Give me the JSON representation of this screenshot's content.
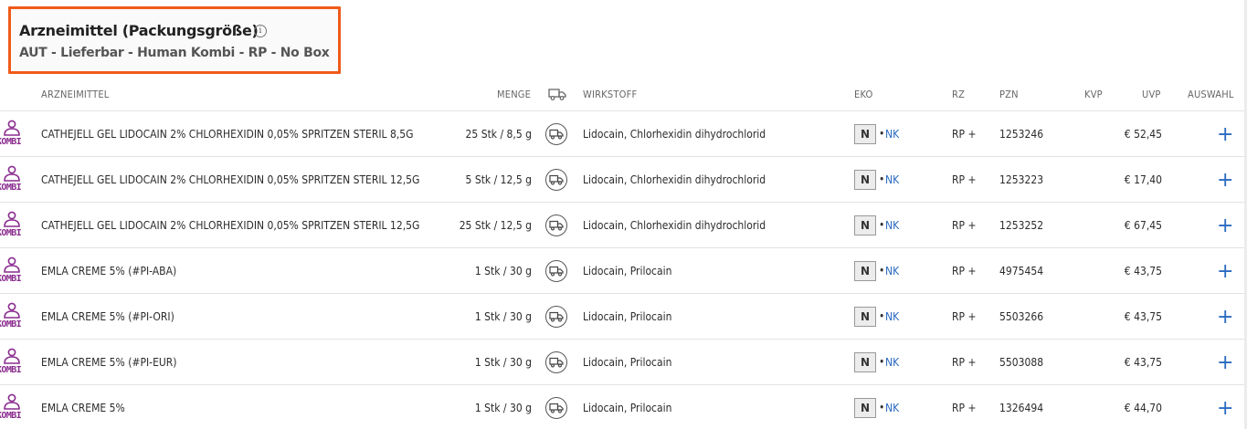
{
  "header": {
    "title": "Arzneimittel (Packungsgröße)",
    "subtitle": "AUT - Lieferbar - Human Kombi - RP - No Box"
  },
  "columns": {
    "name": "ARZNEIMITTEL",
    "menge": "MENGE",
    "delivery_icon": "truck-icon",
    "wirkstoff": "WIRKSTOFF",
    "eko": "EKO",
    "rz": "RZ",
    "pzn": "PZN",
    "kvp": "KVP",
    "uvp": "UVP",
    "auswahl": "AUSWAHL"
  },
  "kombi_label": "KOMBI",
  "rows": [
    {
      "name": "CATHEJELL GEL LIDOCAIN 2% CHLORHEXIDIN 0,05% SPRITZEN STERIL 8,5G",
      "menge": "25 Stk / 8,5 g",
      "wirkstoff": "Lidocain, Chlorhexidin dihydrochlorid",
      "eko": "N",
      "eko_sep": "•",
      "eko_code": "NK",
      "rz": "RP +",
      "pzn": "1253246",
      "kvp": "",
      "uvp": "€ 52,45",
      "add": "+"
    },
    {
      "name": "CATHEJELL GEL LIDOCAIN 2% CHLORHEXIDIN 0,05% SPRITZEN STERIL 12,5G",
      "menge": "5 Stk / 12,5 g",
      "wirkstoff": "Lidocain, Chlorhexidin dihydrochlorid",
      "eko": "N",
      "eko_sep": "•",
      "eko_code": "NK",
      "rz": "RP +",
      "pzn": "1253223",
      "kvp": "",
      "uvp": "€ 17,40",
      "add": "+"
    },
    {
      "name": "CATHEJELL GEL LIDOCAIN 2% CHLORHEXIDIN 0,05% SPRITZEN STERIL 12,5G",
      "menge": "25 Stk / 12,5 g",
      "wirkstoff": "Lidocain, Chlorhexidin dihydrochlorid",
      "eko": "N",
      "eko_sep": "•",
      "eko_code": "NK",
      "rz": "RP +",
      "pzn": "1253252",
      "kvp": "",
      "uvp": "€ 67,45",
      "add": "+"
    },
    {
      "name": "EMLA CREME 5% (#PI-ABA)",
      "menge": "1 Stk / 30 g",
      "wirkstoff": "Lidocain, Prilocain",
      "eko": "N",
      "eko_sep": "•",
      "eko_code": "NK",
      "rz": "RP +",
      "pzn": "4975454",
      "kvp": "",
      "uvp": "€ 43,75",
      "add": "+"
    },
    {
      "name": "EMLA CREME 5% (#PI-ORI)",
      "menge": "1 Stk / 30 g",
      "wirkstoff": "Lidocain, Prilocain",
      "eko": "N",
      "eko_sep": "•",
      "eko_code": "NK",
      "rz": "RP +",
      "pzn": "5503266",
      "kvp": "",
      "uvp": "€ 43,75",
      "add": "+"
    },
    {
      "name": "EMLA CREME 5% (#PI-EUR)",
      "menge": "1 Stk / 30 g",
      "wirkstoff": "Lidocain, Prilocain",
      "eko": "N",
      "eko_sep": "•",
      "eko_code": "NK",
      "rz": "RP +",
      "pzn": "5503088",
      "kvp": "",
      "uvp": "€ 43,75",
      "add": "+"
    },
    {
      "name": "EMLA CREME 5%",
      "menge": "1 Stk / 30 g",
      "wirkstoff": "Lidocain, Prilocain",
      "eko": "N",
      "eko_sep": "•",
      "eko_code": "NK",
      "rz": "RP +",
      "pzn": "1326494",
      "kvp": "",
      "uvp": "€ 44,70",
      "add": "+"
    }
  ],
  "colors": {
    "highlight_border": "#f05a1a",
    "kombi_purple": "#8a2b8f",
    "link_blue": "#2a6ac0"
  }
}
